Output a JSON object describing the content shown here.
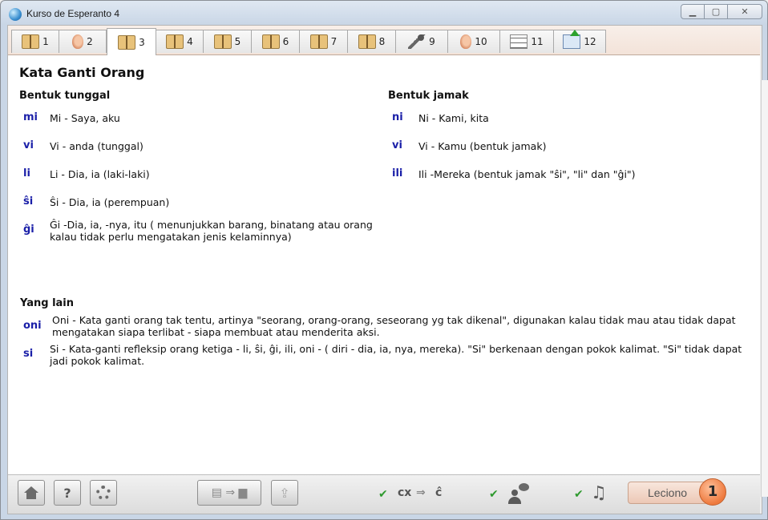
{
  "window": {
    "title": "Kurso de Esperanto 4"
  },
  "tabs": [
    {
      "label": "1",
      "icon": "book-icon"
    },
    {
      "label": "2",
      "icon": "ear-icon"
    },
    {
      "label": "3",
      "icon": "book-icon"
    },
    {
      "label": "4",
      "icon": "book-icon"
    },
    {
      "label": "5",
      "icon": "book-icon"
    },
    {
      "label": "6",
      "icon": "book-icon"
    },
    {
      "label": "7",
      "icon": "book-icon"
    },
    {
      "label": "8",
      "icon": "book-icon"
    },
    {
      "label": "9",
      "icon": "microphone-icon"
    },
    {
      "label": "10",
      "icon": "ear-icon"
    },
    {
      "label": "11",
      "icon": "checklist-icon"
    },
    {
      "label": "12",
      "icon": "send-mail-icon"
    }
  ],
  "active_tab": "3",
  "lesson": {
    "title": "Kata Ganti Orang",
    "singular": {
      "heading": "Bentuk  tunggal",
      "items": [
        {
          "word": "mi",
          "def": "Mi - Saya, aku"
        },
        {
          "word": "vi",
          "def": "Vi - anda (tunggal)"
        },
        {
          "word": "li",
          "def": "Li - Dia, ia (laki-laki)"
        },
        {
          "word": "ŝi",
          "def": "Ŝi - Dia, ia (perempuan)"
        },
        {
          "word": "ĝi",
          "def": "Ĝi -Dia, ia, -nya, itu  ( menunjukkan  barang, binatang atau orang kalau tidak perlu mengatakan jenis kelaminnya)"
        }
      ]
    },
    "plural": {
      "heading": "Bentuk jamak",
      "items": [
        {
          "word": "ni",
          "def": "Ni - Kami, kita"
        },
        {
          "word": "vi",
          "def": "Vi - Kamu (bentuk jamak)"
        },
        {
          "word": "ili",
          "def": "Ili -Mereka (bentuk jamak  \"ŝi\", \"li\" dan \"ĝi\")"
        }
      ]
    },
    "others": {
      "heading": "Yang lain",
      "items": [
        {
          "word": "oni",
          "def": "Oni - Kata ganti orang tak tentu, artinya \"seorang, orang-orang, seseorang yg tak dikenal\", digunakan kalau tidak mau atau tidak dapat mengatakan siapa terlibat - siapa membuat atau menderita aksi."
        },
        {
          "word": "si",
          "def": "Si - Kata-ganti refleksip orang ketiga  - li, ŝi, ĝi, ili, oni - ( diri - dia, ia, nya, mereka).  \"Si\" berkenaan dengan pokok kalimat.  \"Si\" tidak dapat jadi pokok kalimat."
        }
      ]
    }
  },
  "toolbar": {
    "cx_label": "cx",
    "arrow": "⇒",
    "cx_result": "ĉ",
    "help_label": "?",
    "leciono_label": "Leciono",
    "leciono_number": "1",
    "check": "✔",
    "note": "♫"
  }
}
